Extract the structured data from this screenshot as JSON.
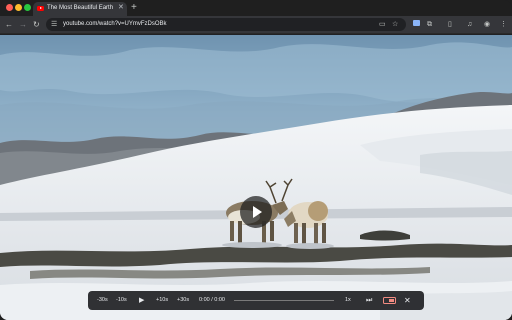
{
  "tab": {
    "title": "The Most Beautiful Earth Sce",
    "close_icon": "close-icon",
    "new_tab_label": "+"
  },
  "toolbar": {
    "url": "youtube.com/watch?v=UYmvFzDsOBk"
  },
  "player": {
    "controls": {
      "back30": "-30s",
      "back10": "-10s",
      "play": "▶",
      "fwd10": "+10s",
      "fwd30": "+30s",
      "time": "0:00 / 0:00",
      "speed": "1x",
      "progress": 0
    }
  },
  "colors": {
    "accent_red": "#ff0000",
    "pip_active": "#f28b82"
  }
}
